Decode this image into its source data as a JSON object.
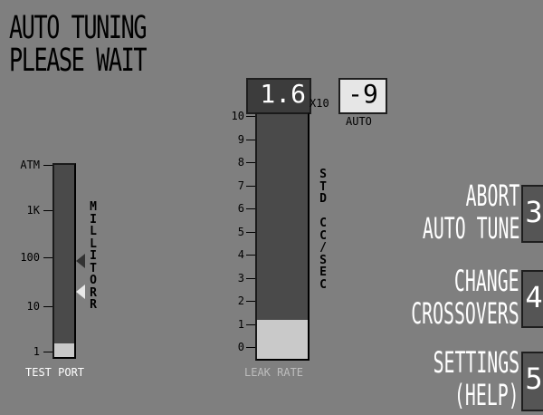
{
  "status": {
    "line1": "AUTO TUNING",
    "line2": "PLEASE WAIT"
  },
  "test_port": {
    "label": "TEST PORT",
    "unit": "MILLITORR",
    "scale": [
      "ATM",
      "1K",
      "100",
      "10",
      "1"
    ],
    "fill_fraction": 0.07
  },
  "leak_rate": {
    "label": "LEAK RATE",
    "unit": "STD CC/SEC",
    "mantissa": "1.6",
    "multiplier": "X10",
    "exponent": "-9",
    "range_mode": "AUTO",
    "scale": [
      "10",
      "9",
      "8",
      "7",
      "6",
      "5",
      "4",
      "3",
      "2",
      "1",
      "0"
    ],
    "fill_fraction": 0.16
  },
  "buttons": [
    {
      "line1": "ABORT",
      "line2": "AUTO TUNE",
      "key": "3"
    },
    {
      "line1": "CHANGE",
      "line2": "CROSSOVERS",
      "key": "4"
    },
    {
      "line1": "SETTINGS",
      "line2": "(HELP)",
      "key": "5"
    }
  ],
  "colors": {
    "background": "#7f7f7f",
    "track": "#4a4a4a",
    "fill": "#c9c9c9",
    "label": "#ffffff"
  }
}
